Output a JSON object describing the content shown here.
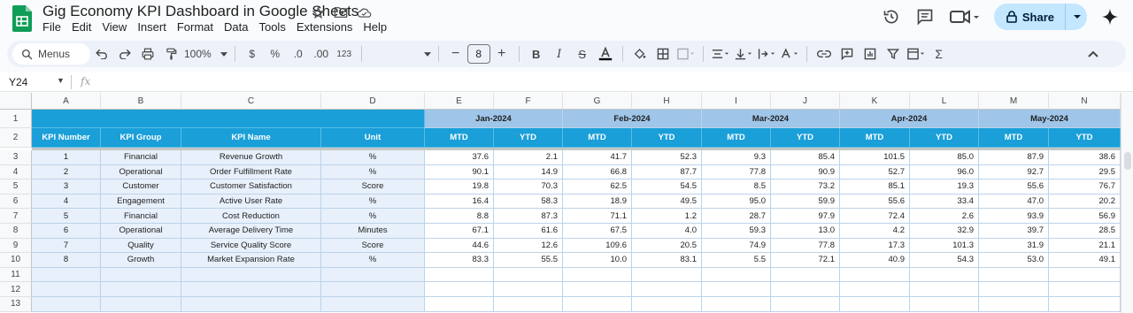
{
  "app": {
    "title": "Gig Economy KPI Dashboard in Google Sheets",
    "menus": [
      "File",
      "Edit",
      "View",
      "Insert",
      "Format",
      "Data",
      "Tools",
      "Extensions",
      "Help"
    ],
    "share_label": "Share"
  },
  "toolbar": {
    "menus_label": "Menus",
    "zoom": "100%",
    "currency": "$",
    "percent": "%",
    "dec_decrease": ".0",
    "dec_increase": ".00",
    "number_format": "123",
    "font_size": "8"
  },
  "formula": {
    "cell_ref": "Y24",
    "fx": "fx"
  },
  "columns": [
    "A",
    "B",
    "C",
    "D",
    "E",
    "F",
    "G",
    "H",
    "I",
    "J",
    "K",
    "L",
    "M",
    "N"
  ],
  "rows": [
    "1",
    "2",
    "3",
    "4",
    "5",
    "6",
    "7",
    "8",
    "9",
    "10",
    "11",
    "12",
    "13"
  ],
  "months": [
    "Jan-2024",
    "Feb-2024",
    "Mar-2024",
    "Apr-2024",
    "May-2024"
  ],
  "headers": {
    "kpi_number": "KPI Number",
    "kpi_group": "KPI Group",
    "kpi_name": "KPI Name",
    "unit": "Unit",
    "mtd": "MTD",
    "ytd": "YTD"
  },
  "kpis": [
    {
      "num": "1",
      "group": "Financial",
      "name": "Revenue Growth",
      "unit": "%",
      "values": [
        "37.6",
        "2.1",
        "41.7",
        "52.3",
        "9.3",
        "85.4",
        "101.5",
        "85.0",
        "87.9",
        "38.6"
      ]
    },
    {
      "num": "2",
      "group": "Operational",
      "name": "Order Fulfillment Rate",
      "unit": "%",
      "values": [
        "90.1",
        "14.9",
        "66.8",
        "87.7",
        "77.8",
        "90.9",
        "52.7",
        "96.0",
        "92.7",
        "29.5"
      ]
    },
    {
      "num": "3",
      "group": "Customer",
      "name": "Customer Satisfaction",
      "unit": "Score",
      "values": [
        "19.8",
        "70.3",
        "62.5",
        "54.5",
        "8.5",
        "73.2",
        "85.1",
        "19.3",
        "55.6",
        "76.7"
      ]
    },
    {
      "num": "4",
      "group": "Engagement",
      "name": "Active User Rate",
      "unit": "%",
      "values": [
        "16.4",
        "58.3",
        "18.9",
        "49.5",
        "95.0",
        "59.9",
        "55.6",
        "33.4",
        "47.0",
        "20.2"
      ]
    },
    {
      "num": "5",
      "group": "Financial",
      "name": "Cost Reduction",
      "unit": "%",
      "values": [
        "8.8",
        "87.3",
        "71.1",
        "1.2",
        "28.7",
        "97.9",
        "72.4",
        "2.6",
        "93.9",
        "56.9"
      ]
    },
    {
      "num": "6",
      "group": "Operational",
      "name": "Average Delivery Time",
      "unit": "Minutes",
      "values": [
        "67.1",
        "61.6",
        "67.5",
        "4.0",
        "59.3",
        "13.0",
        "4.2",
        "32.9",
        "39.7",
        "28.5"
      ]
    },
    {
      "num": "7",
      "group": "Quality",
      "name": "Service Quality Score",
      "unit": "Score",
      "values": [
        "44.6",
        "12.6",
        "109.6",
        "20.5",
        "74.9",
        "77.8",
        "17.3",
        "101.3",
        "31.9",
        "21.1"
      ]
    },
    {
      "num": "8",
      "group": "Growth",
      "name": "Market Expansion Rate",
      "unit": "%",
      "values": [
        "83.3",
        "55.5",
        "10.0",
        "83.1",
        "5.5",
        "72.1",
        "40.9",
        "54.3",
        "53.0",
        "49.1"
      ]
    }
  ],
  "colors": {
    "header_dark": "#1a9fd8",
    "header_month": "#9fc5e8",
    "meta_fill": "#e8f0fb",
    "share_bg": "#c2e7ff"
  }
}
